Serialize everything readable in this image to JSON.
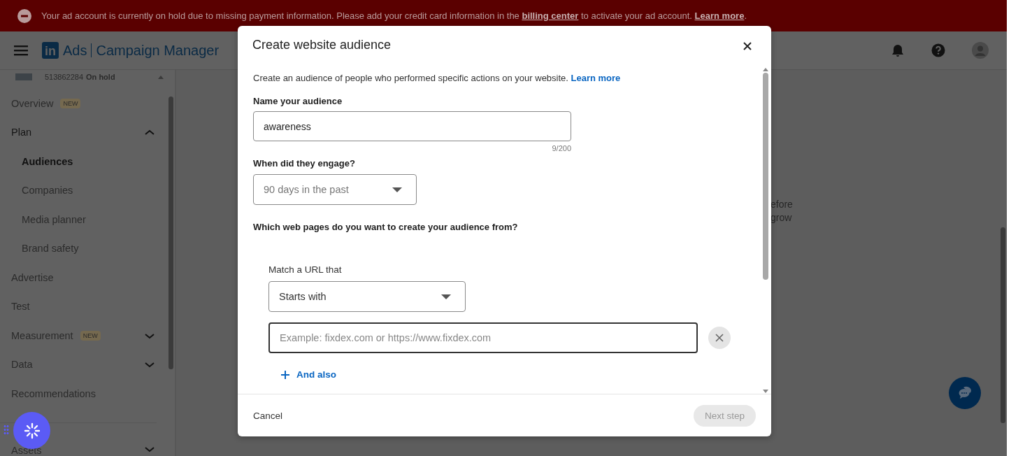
{
  "banner": {
    "text_before": "Your ad account is currently on hold due to missing payment information. Please add your credit card information in the ",
    "link": "billing center",
    "text_after": " to activate your ad account.",
    "learn_more": "Learn more",
    "end": "."
  },
  "header": {
    "logo_mark": "in",
    "product": "Ads",
    "title": "Campaign Manager"
  },
  "account": {
    "id": "513862284",
    "status": "On hold"
  },
  "nav": [
    {
      "label": "Overview",
      "badge": "NEW",
      "selected": false
    },
    {
      "label": "Plan",
      "selected": false,
      "expanded": true,
      "children": [
        {
          "label": "Audiences",
          "selected": true
        },
        {
          "label": "Companies",
          "selected": false
        },
        {
          "label": "Media planner",
          "selected": false
        },
        {
          "label": "Brand safety",
          "selected": false
        }
      ]
    },
    {
      "label": "Advertise",
      "selected": false
    },
    {
      "label": "Test",
      "selected": false
    },
    {
      "label": "Measurement",
      "badge": "NEW",
      "selected": false,
      "expanded": false
    },
    {
      "label": "Data",
      "selected": false,
      "expanded": false
    },
    {
      "label": "Recommendations",
      "selected": false
    },
    {
      "label": "Assets",
      "selected": false,
      "expanded": false
    }
  ],
  "main": {
    "text_lines": [
      "efore",
      "grow"
    ]
  },
  "modal": {
    "title": "Create website audience",
    "intro": "Create an audience of people who performed specific actions on your website.",
    "learn_more": "Learn more",
    "name_label": "Name your audience",
    "name_value": "awareness",
    "counter": "9/200",
    "engage_label": "When did they engage?",
    "engage_value": "90 days in the past",
    "pages_label": "Which web pages do you want to create your audience from?",
    "match_label": "Match a URL that",
    "match_value": "Starts with",
    "url_placeholder": "Example: fixdex.com or https://www.fixdex.com",
    "and_also": "And also",
    "cancel": "Cancel",
    "next": {
      "label": "Next step",
      "disabled": true
    }
  }
}
